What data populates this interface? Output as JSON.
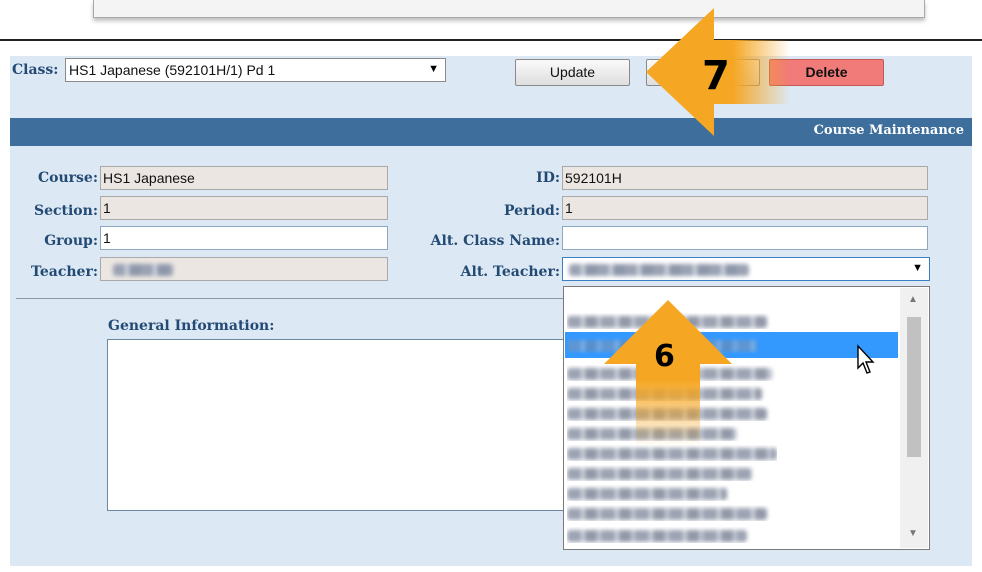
{
  "toolbar": {
    "class_label": "Class:",
    "class_value": "HS1 Japanese (592101H/1) Pd 1",
    "update_label": "Update",
    "blank_button_label": "",
    "delete_label": "Delete"
  },
  "header": {
    "title": "Course Maintenance"
  },
  "form": {
    "course_label": "Course:",
    "course_value": "HS1  Japanese",
    "id_label": "ID:",
    "id_value": "592101H",
    "section_label": "Section:",
    "section_value": "1",
    "period_label": "Period:",
    "period_value": "1",
    "group_label": "Group:",
    "group_value": "1",
    "alt_class_label": "Alt. Class Name:",
    "alt_class_value": "",
    "teacher_label": "Teacher:",
    "alt_teacher_label": "Alt. Teacher:",
    "general_info_label": "General Information:"
  },
  "callouts": {
    "step6": "6",
    "step7": "7"
  },
  "colors": {
    "accent_arrow": "#f5a623",
    "header_bar": "#3d6e9c",
    "delete": "#f07b78",
    "selection": "#3399ff"
  },
  "icons": {
    "dropdown": "chevron-down-icon",
    "cursor": "mouse-pointer-icon"
  }
}
